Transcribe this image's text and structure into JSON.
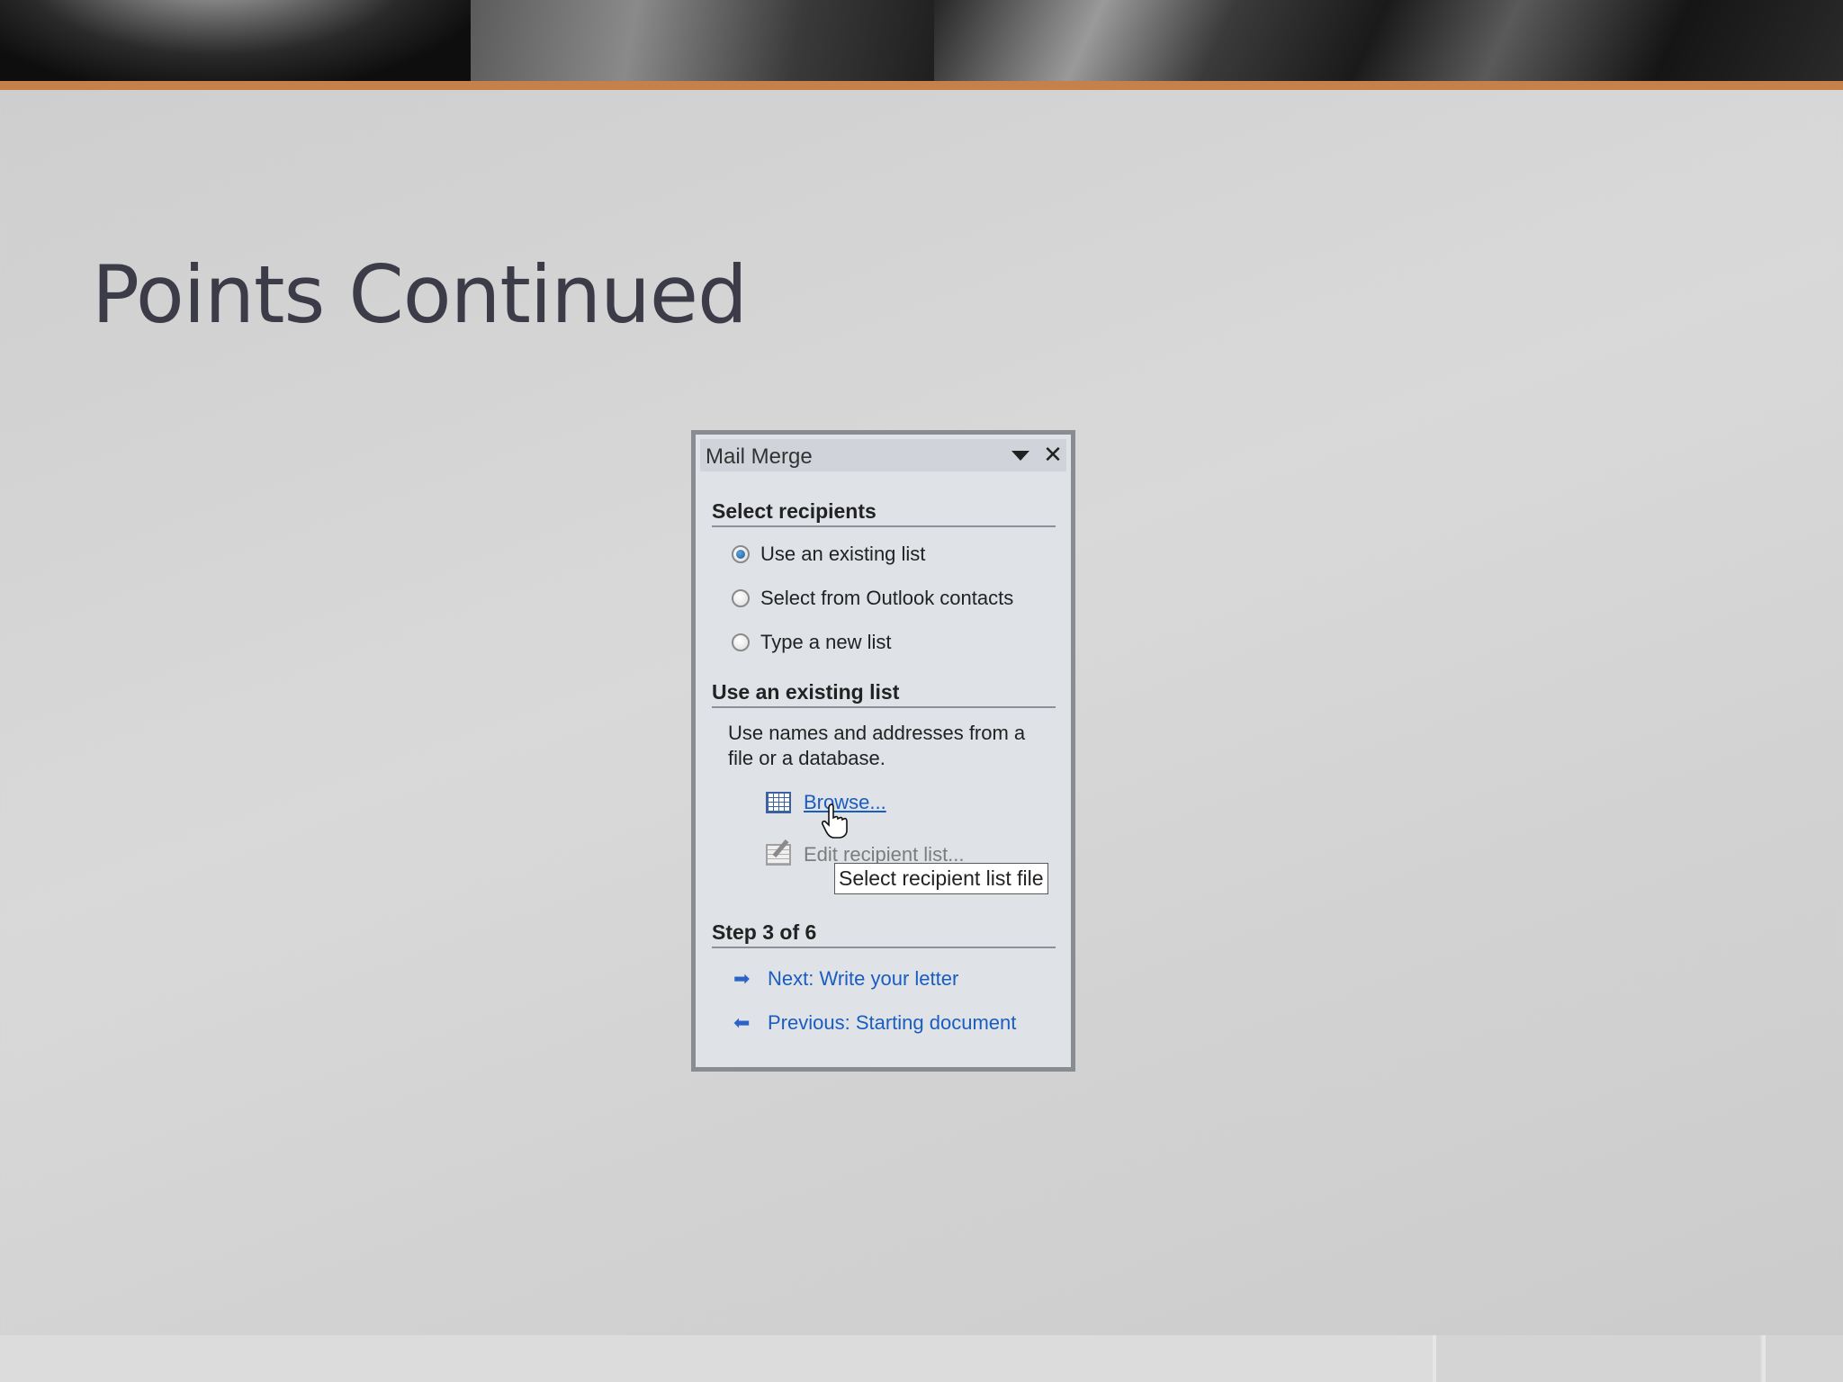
{
  "slide": {
    "title": "Points Continued",
    "accent_color": "#c6814a"
  },
  "pane": {
    "title": "Mail Merge",
    "dropdown_icon": "triangle-down-icon",
    "close_glyph": "✕",
    "section_recipients": "Select recipients",
    "options": [
      {
        "label": "Use an existing list",
        "selected": true
      },
      {
        "label": "Select from Outlook contacts",
        "selected": false
      },
      {
        "label": "Type a new list",
        "selected": false
      }
    ],
    "section_existing": "Use an existing list",
    "description": "Use names and addresses from a file or a database.",
    "browse_label": "Browse...",
    "edit_label": "Edit recipient list...",
    "tooltip": "Select recipient list file",
    "step_label": "Step 3 of 6",
    "next_label": "Next: Write your letter",
    "previous_label": "Previous: Starting document",
    "link_color": "#1a5dbf"
  }
}
